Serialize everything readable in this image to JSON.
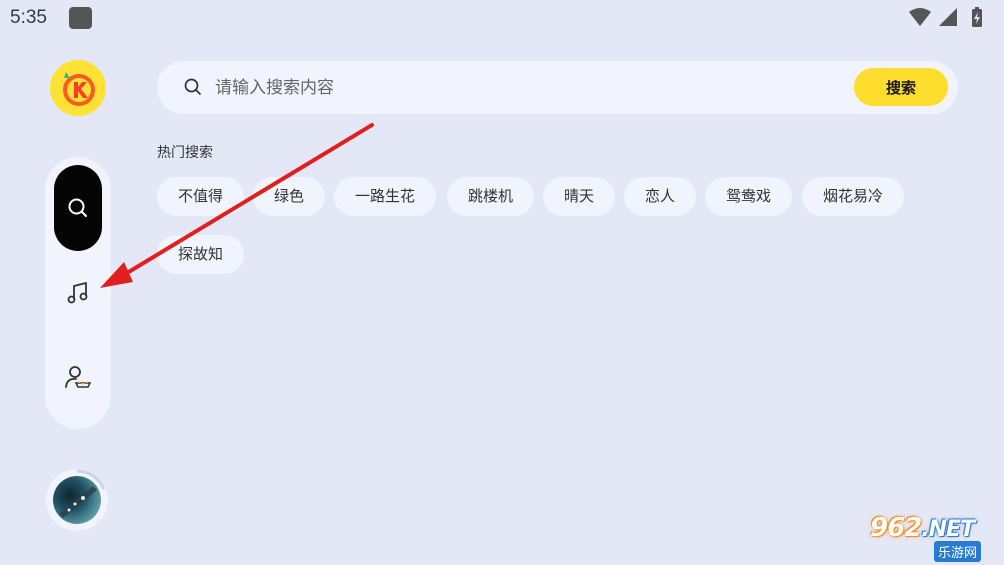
{
  "status_bar": {
    "time": "5:35"
  },
  "search": {
    "placeholder": "请输入搜索内容",
    "button_label": "搜索"
  },
  "hot_search": {
    "title": "热门搜索",
    "tags": [
      "不值得",
      "绿色",
      "一路生花",
      "跳楼机",
      "晴天",
      "恋人",
      "鸳鸯戏",
      "烟花易冷",
      "探故知"
    ]
  },
  "side_nav": {
    "items": [
      {
        "name": "search",
        "icon": "search-icon",
        "active": true
      },
      {
        "name": "music",
        "icon": "music-note-icon",
        "active": false
      },
      {
        "name": "profile",
        "icon": "user-vip-icon",
        "active": false
      }
    ]
  },
  "watermark": {
    "main": "962",
    "domain": ".NET",
    "sub": "乐游网"
  },
  "colors": {
    "background": "#e4e7f6",
    "accent": "#ffdd2e",
    "nav_active": "#050505",
    "annotation_arrow": "#e02020"
  }
}
